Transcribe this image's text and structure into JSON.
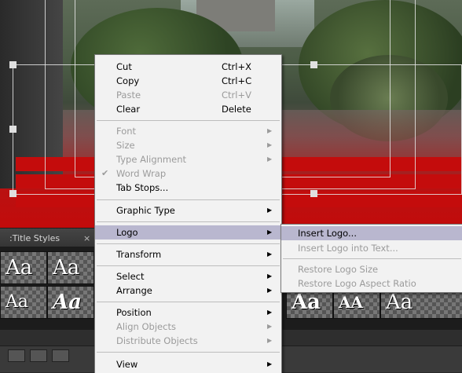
{
  "panel": {
    "tab_label": ":Title Styles",
    "close_glyph": "×"
  },
  "styles": [
    {
      "text": "Aa"
    },
    {
      "text": "Aa"
    },
    {
      "text": "Aa"
    },
    {
      "text": "Aa"
    },
    {
      "text": "Aa"
    },
    {
      "text": "Aa"
    },
    {
      "text": "Aa"
    },
    {
      "text": "Aa"
    },
    {
      "text": "AA"
    },
    {
      "text": "Aa"
    }
  ],
  "context_menu": {
    "items": [
      {
        "label": "Cut",
        "shortcut": "Ctrl+X",
        "enabled": true
      },
      {
        "label": "Copy",
        "shortcut": "Ctrl+C",
        "enabled": true
      },
      {
        "label": "Paste",
        "shortcut": "Ctrl+V",
        "enabled": false
      },
      {
        "label": "Clear",
        "shortcut": "Delete",
        "enabled": true
      },
      {
        "label": "Font",
        "enabled": false,
        "submenu": true
      },
      {
        "label": "Size",
        "enabled": false,
        "submenu": true
      },
      {
        "label": "Type Alignment",
        "enabled": false,
        "submenu": true
      },
      {
        "label": "Word Wrap",
        "enabled": false,
        "checked": true
      },
      {
        "label": "Tab Stops...",
        "enabled": true
      },
      {
        "label": "Graphic Type",
        "enabled": true,
        "submenu": true
      },
      {
        "label": "Logo",
        "enabled": true,
        "submenu": true,
        "highlighted": true
      },
      {
        "label": "Transform",
        "enabled": true,
        "submenu": true
      },
      {
        "label": "Select",
        "enabled": true,
        "submenu": true
      },
      {
        "label": "Arrange",
        "enabled": true,
        "submenu": true
      },
      {
        "label": "Position",
        "enabled": true,
        "submenu": true
      },
      {
        "label": "Align Objects",
        "enabled": false,
        "submenu": true
      },
      {
        "label": "Distribute Objects",
        "enabled": false,
        "submenu": true
      },
      {
        "label": "View",
        "enabled": true,
        "submenu": true
      }
    ],
    "check_glyph": "✔",
    "arrow_glyph": "▶"
  },
  "logo_submenu": {
    "items": [
      {
        "label": "Insert Logo...",
        "enabled": true,
        "highlighted": true
      },
      {
        "label": "Insert Logo into Text...",
        "enabled": false
      },
      {
        "label": "Restore Logo Size",
        "enabled": false
      },
      {
        "label": "Restore Logo Aspect Ratio",
        "enabled": false
      }
    ]
  },
  "colors": {
    "menu_bg": "#f2f2f2",
    "highlight": "#b9b7cf",
    "disabled_text": "#9b9b9b",
    "title_red": "#c40c0c"
  }
}
